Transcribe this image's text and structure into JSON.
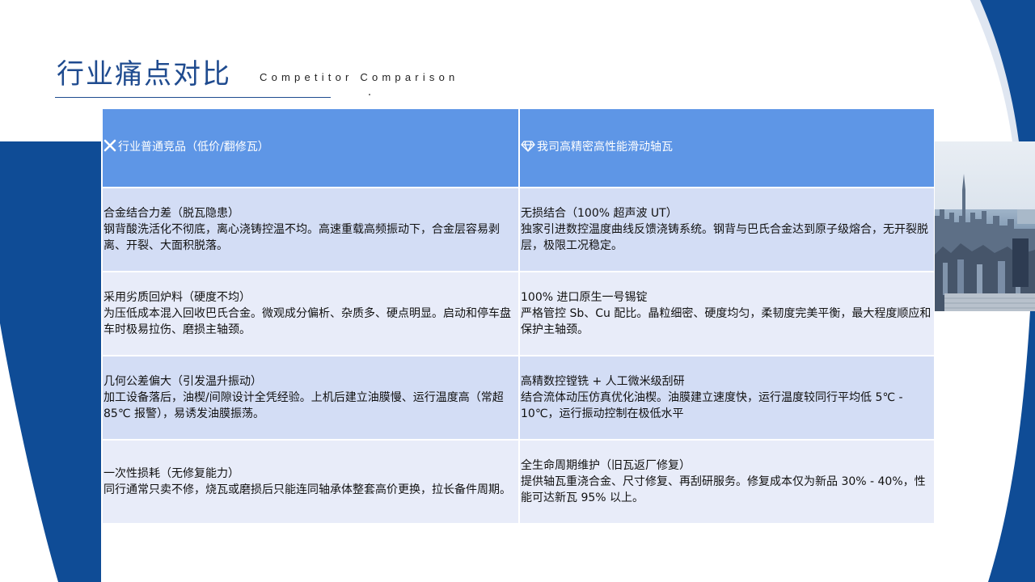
{
  "header": {
    "title": "行业痛点对比",
    "subtitle": "Competitor Comparison"
  },
  "table": {
    "headers": {
      "left": {
        "icon": "x-icon",
        "label": "行业普通竞品（低价/翻修瓦）"
      },
      "right": {
        "icon": "diamond-icon",
        "label": "我司高精密高性能滑动轴瓦"
      }
    },
    "rows": [
      {
        "left_title": "合金结合力差（脱瓦隐患）",
        "left_desc": "钢背酸洗活化不彻底，离心浇铸控温不均。高速重载高频振动下，合金层容易剥离、开裂、大面积脱落。",
        "right_title": "无损结合（100% 超声波 UT）",
        "right_desc": "独家引进数控温度曲线反馈浇铸系统。钢背与巴氏合金达到原子级熔合，无开裂脱层，极限工况稳定。"
      },
      {
        "left_title": "采用劣质回炉料（硬度不均）",
        "left_desc": "为压低成本混入回收巴氏合金。微观成分偏析、杂质多、硬点明显。启动和停车盘车时极易拉伤、磨损主轴颈。",
        "right_title": "100% 进口原生一号锡锭",
        "right_desc": "严格管控 Sb、Cu 配比。晶粒细密、硬度均匀，柔韧度完美平衡，最大程度顺应和保护主轴颈。"
      },
      {
        "left_title": "几何公差偏大（引发温升振动）",
        "left_desc": "加工设备落后，油楔/间隙设计全凭经验。上机后建立油膜慢、运行温度高（常超 85℃ 报警），易诱发油膜振荡。",
        "right_title": "高精数控镗铣 + 人工微米级刮研",
        "right_desc": "结合流体动压仿真优化油楔。油膜建立速度快，运行温度较同行平均低 5℃ - 10℃，运行振动控制在极低水平"
      },
      {
        "left_title": "一次性损耗（无修复能力）",
        "left_desc": "同行通常只卖不修，烧瓦或磨损后只能连同轴承体整套高价更换，拉长备件周期。",
        "right_title": "全生命周期维护（旧瓦返厂修复）",
        "right_desc": "提供轴瓦重浇合金、尺寸修复、再刮研服务。修复成本仅为新品 30% - 40%，性能可达新瓦 95% 以上。"
      }
    ]
  },
  "colors": {
    "accent_navy": "#1f4b8f",
    "header_blue": "#5e96e6",
    "row_blue": "#d3ddf5",
    "row_light": "#e8ecf9"
  },
  "decor": {
    "photo": "city-skyline-photo"
  }
}
